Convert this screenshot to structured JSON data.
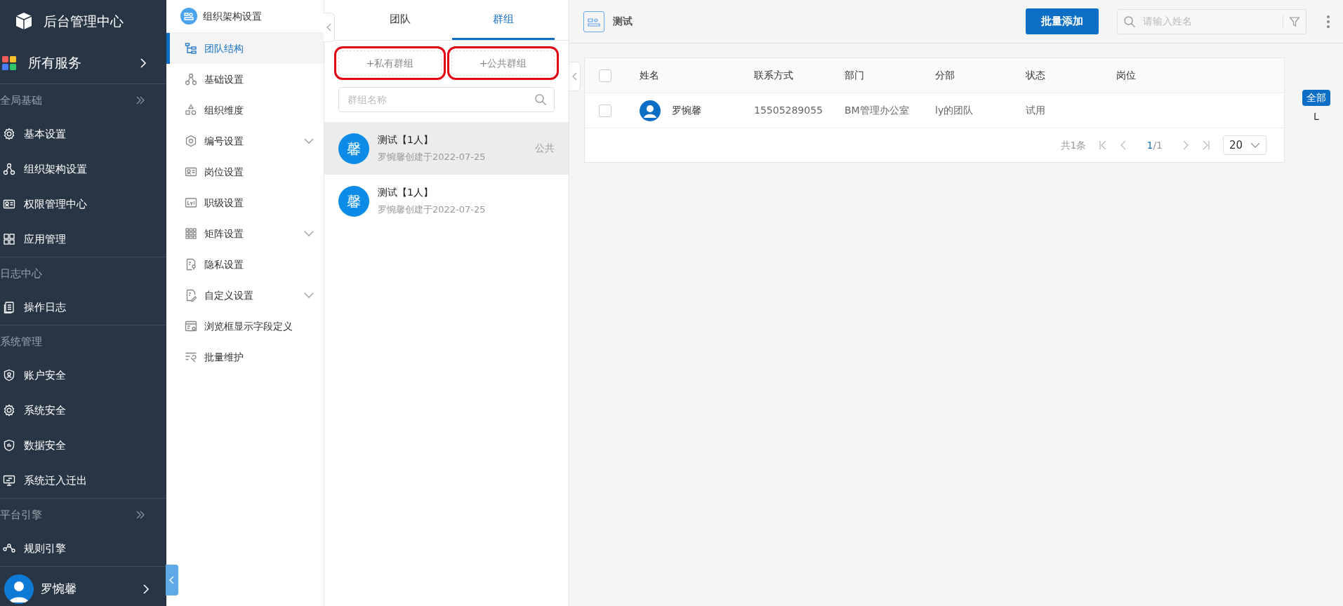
{
  "app": {
    "title": "后台管理中心"
  },
  "services": {
    "label": "所有服务"
  },
  "nav_sections": [
    {
      "title": "全局基础",
      "collapsible": true,
      "items": [
        {
          "label": "基本设置"
        },
        {
          "label": "组织架构设置"
        },
        {
          "label": "权限管理中心"
        },
        {
          "label": "应用管理"
        }
      ]
    },
    {
      "title": "日志中心",
      "collapsible": false,
      "items": [
        {
          "label": "操作日志"
        }
      ]
    },
    {
      "title": "系统管理",
      "collapsible": false,
      "items": [
        {
          "label": "账户安全"
        },
        {
          "label": "系统安全"
        },
        {
          "label": "数据安全"
        },
        {
          "label": "系统迁入迁出"
        }
      ]
    },
    {
      "title": "平台引擎",
      "collapsible": true,
      "items": [
        {
          "label": "规则引擎"
        }
      ]
    }
  ],
  "user": {
    "name": "罗惋馨"
  },
  "sub_nav": {
    "title": "组织架构设置",
    "items": [
      {
        "label": "团队结构",
        "selected": true,
        "expandable": false
      },
      {
        "label": "基础设置",
        "selected": false,
        "expandable": false
      },
      {
        "label": "组织维度",
        "selected": false,
        "expandable": false
      },
      {
        "label": "编号设置",
        "selected": false,
        "expandable": true
      },
      {
        "label": "岗位设置",
        "selected": false,
        "expandable": false
      },
      {
        "label": "职级设置",
        "selected": false,
        "expandable": false
      },
      {
        "label": "矩阵设置",
        "selected": false,
        "expandable": true
      },
      {
        "label": "隐私设置",
        "selected": false,
        "expandable": false
      },
      {
        "label": "自定义设置",
        "selected": false,
        "expandable": true
      },
      {
        "label": "浏览框显示字段定义",
        "selected": false,
        "expandable": false
      },
      {
        "label": "批量维护",
        "selected": false,
        "expandable": false
      }
    ]
  },
  "group_panel": {
    "tabs": [
      {
        "label": "团队",
        "selected": false
      },
      {
        "label": "群组",
        "selected": true
      }
    ],
    "buttons": [
      {
        "label": "+私有群组",
        "highlighted": true
      },
      {
        "label": "+公共群组",
        "highlighted": true
      }
    ],
    "search": {
      "placeholder": "群组名称"
    },
    "groups": [
      {
        "avatar": "馨",
        "name": "测试【1人】",
        "subtitle": "罗惋馨创建于2022-07-25",
        "tag": "公共",
        "selected": true
      },
      {
        "avatar": "馨",
        "name": "测试【1人】",
        "subtitle": "罗惋馨创建于2022-07-25",
        "selected": false
      }
    ]
  },
  "main": {
    "title": "测试",
    "add_button": "批量添加",
    "search": {
      "placeholder": "请输入姓名"
    },
    "table": {
      "columns": [
        "姓名",
        "联系方式",
        "部门",
        "分部",
        "状态",
        "岗位"
      ],
      "header_checked": false,
      "rows": [
        {
          "checked": false,
          "name": "罗惋馨",
          "phone": "15505289055",
          "department": "BM管理办公室",
          "branch": "ly的团队",
          "status": "试用"
        }
      ]
    },
    "pagination": {
      "total": "共1条",
      "current": "1",
      "pages": "/1",
      "page_size": "20"
    },
    "letter_index": [
      {
        "label": "全部",
        "selected": true
      },
      {
        "label": "L",
        "selected": false
      }
    ]
  }
}
